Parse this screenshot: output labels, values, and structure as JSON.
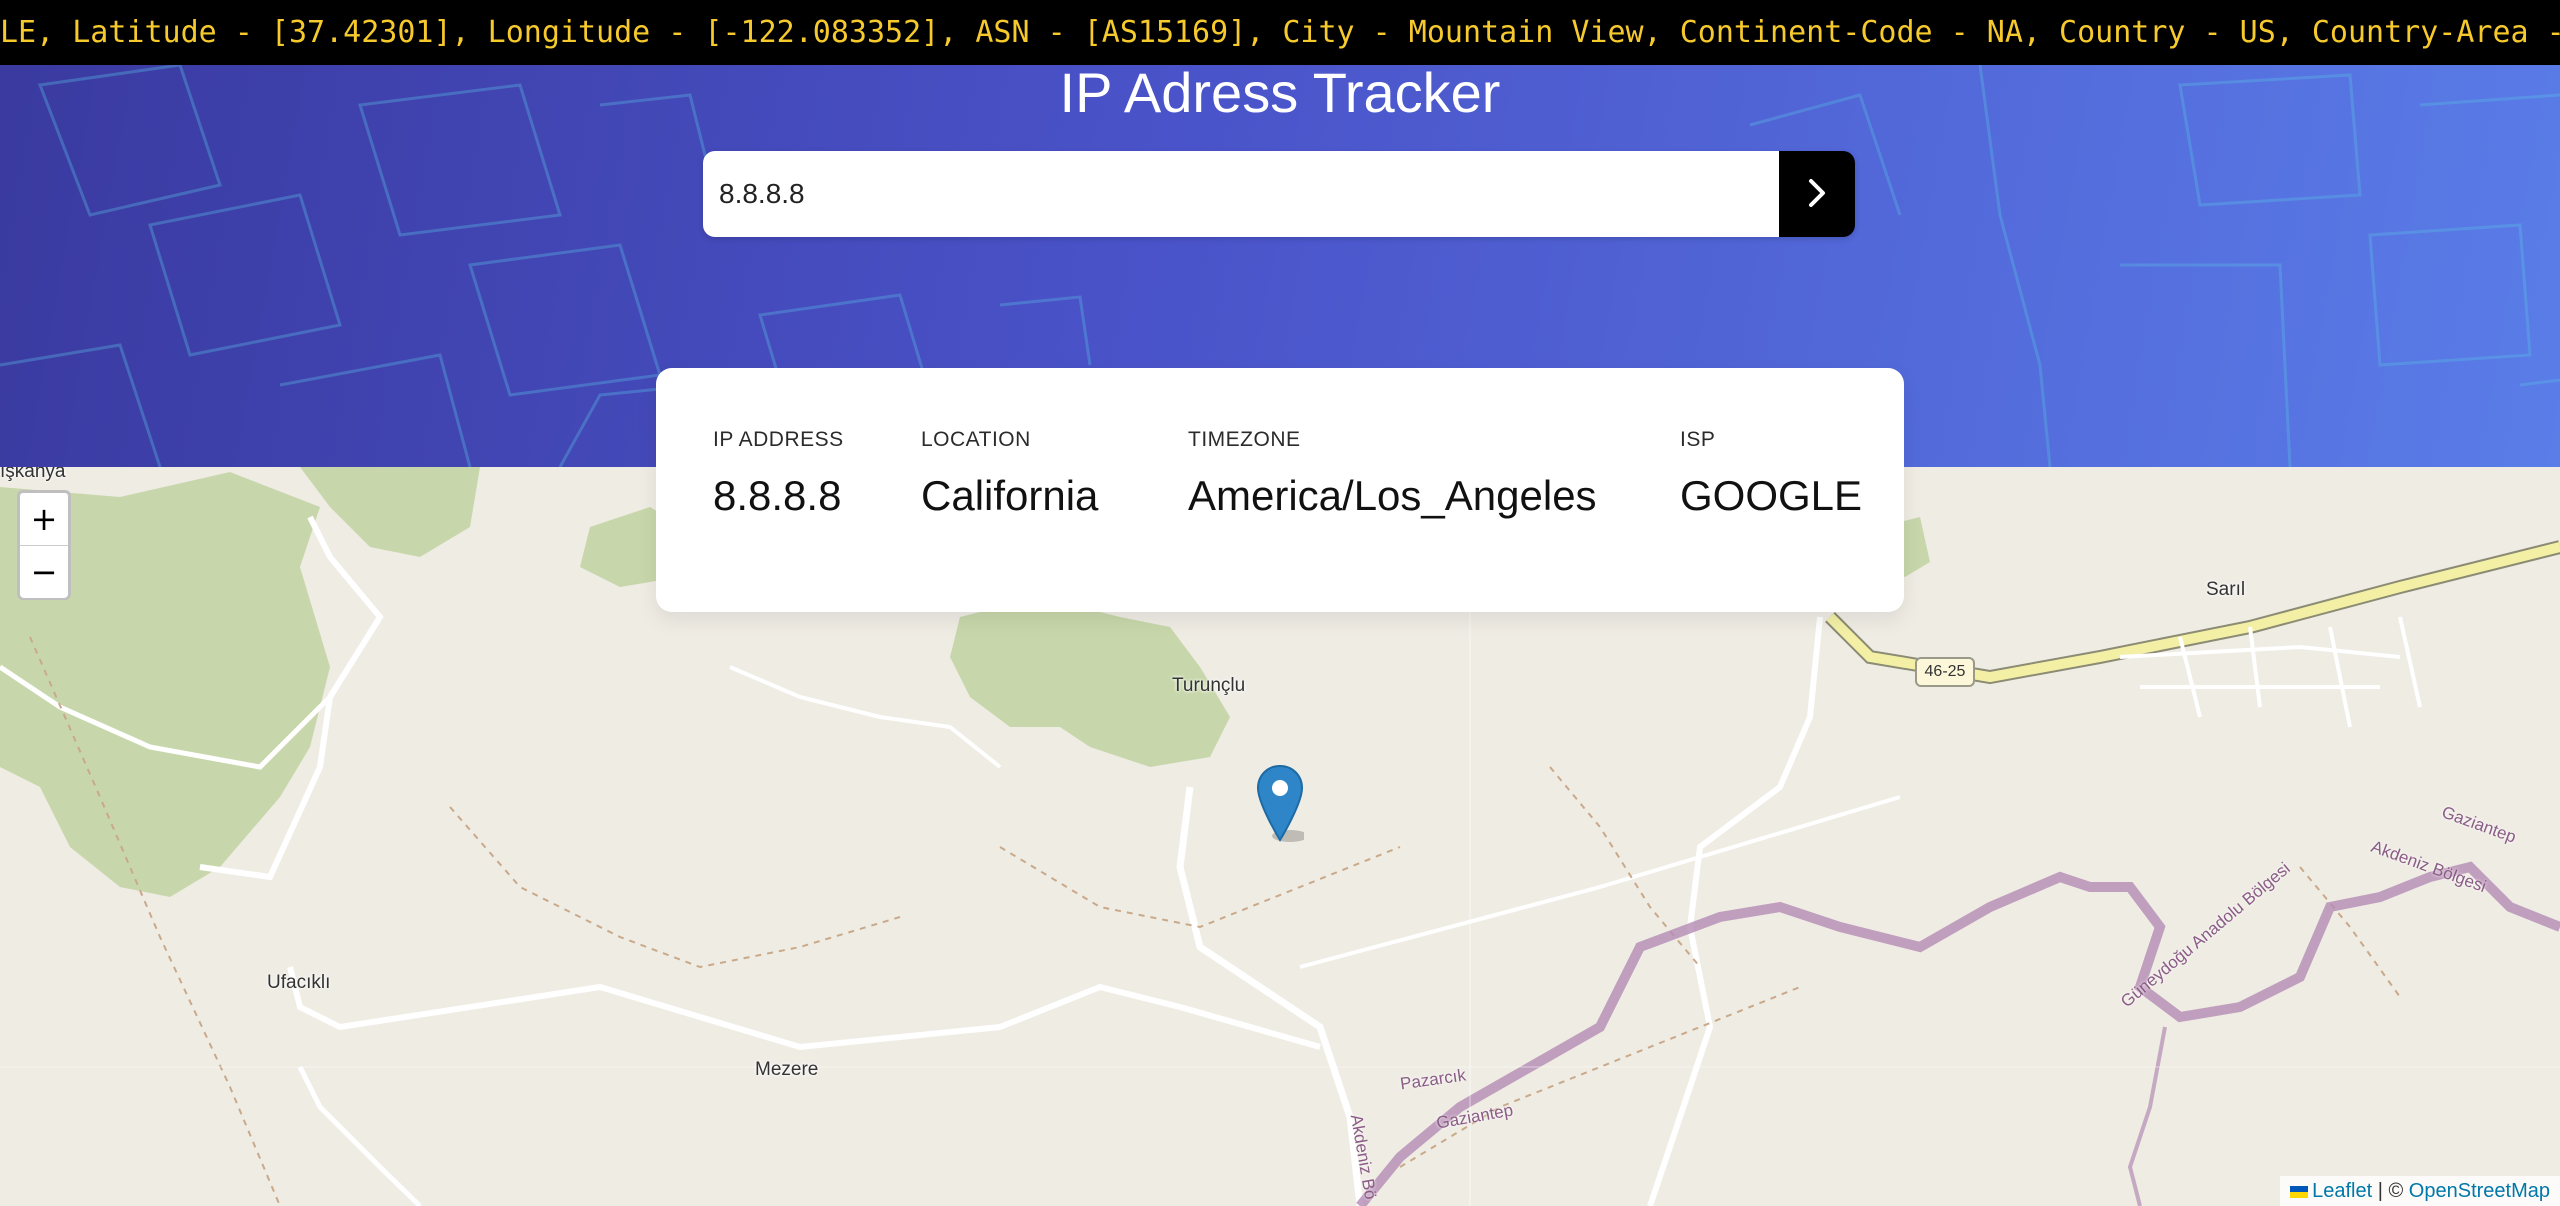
{
  "ticker": {
    "text": "LE, Latitude - [37.42301], Longitude - [-122.083352], ASN - [AS15169], City - Mountain View, Continent-Code - NA, Country - US, Country-Area - ["
  },
  "header": {
    "title": "IP Adress Tracker"
  },
  "search": {
    "value": "8.8.8.8",
    "icon": "chevron-right-icon"
  },
  "info": {
    "ip_label": "IP ADDRESS",
    "ip_value": "8.8.8.8",
    "location_label": "LOCATION",
    "location_value": "California",
    "timezone_label": "TIMEZONE",
    "timezone_value": "America/Los_Angeles",
    "isp_label": "ISP",
    "isp_value": "GOOGLE"
  },
  "map": {
    "zoom_in_label": "+",
    "zoom_out_label": "−",
    "places": {
      "iskanya": "ışkanya",
      "turunclu": "Turunçlu",
      "ufacikli": "Ufacıklı",
      "mezere": "Mezere",
      "saril": "Sarıl",
      "pazarcik": "Pazarcık",
      "gaziantep": "Gaziantep",
      "gaziantep2": "Gaziantep",
      "akdeniz_bolgesi": "Akdeniz Bölgesi",
      "akdeniz_bo": "Akdeniz Bö",
      "guneydogu": "Güneydoğu Anadolu Bölgesi"
    },
    "road_number": "46-25",
    "attribution": {
      "leaflet": "Leaflet",
      "separator": " | © ",
      "osm": "OpenStreetMap"
    },
    "marker_icon": "map-marker-icon"
  },
  "colors": {
    "ticker_bg": "#000000",
    "ticker_text": "#f6c92c",
    "hero_start": "#3a3aa0",
    "hero_end": "#5a7de8",
    "marker": "#2e86c9"
  }
}
